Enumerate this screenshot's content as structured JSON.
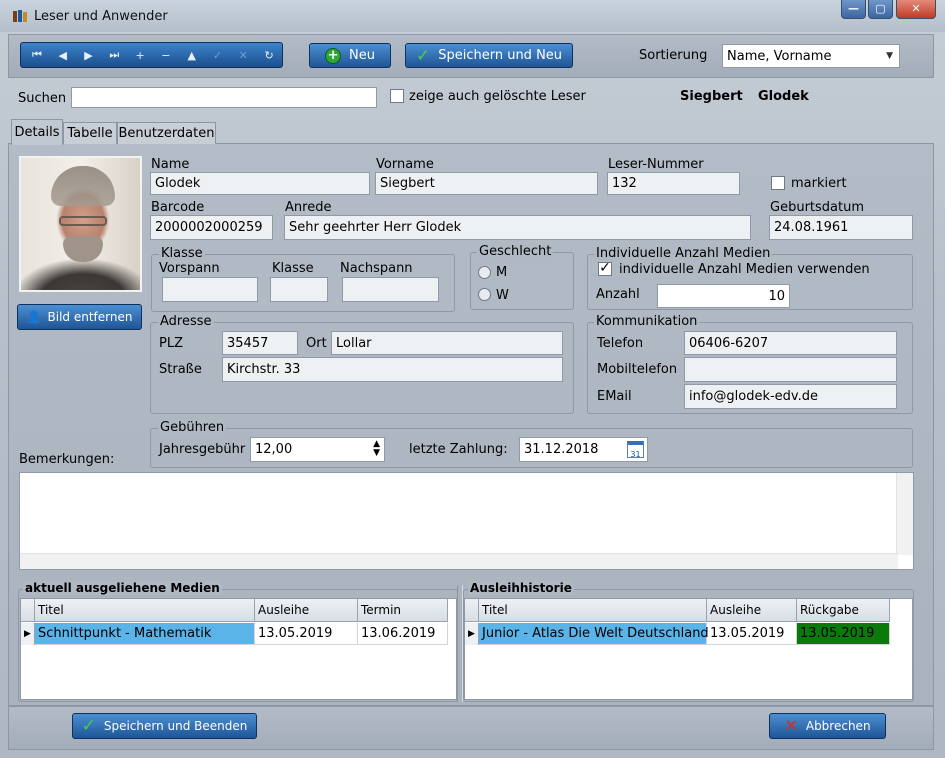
{
  "window": {
    "title": "Leser und Anwender",
    "min_glyph": "—",
    "max_glyph": "▢",
    "close_glyph": "✕"
  },
  "toolbar": {
    "nav_buttons": [
      {
        "glyph": "⏮"
      },
      {
        "glyph": "◀"
      },
      {
        "glyph": "▶"
      },
      {
        "glyph": "⏭"
      },
      {
        "glyph": "+"
      },
      {
        "glyph": "−"
      },
      {
        "glyph": "▲"
      },
      {
        "glyph": "✓"
      },
      {
        "glyph": "✕"
      },
      {
        "glyph": "↻"
      }
    ],
    "new_label": "Neu",
    "save_new_label": "Speichern und Neu",
    "sort_label": "Sortierung",
    "sort_value": "Name, Vorname",
    "sort_arrow": "▼"
  },
  "search": {
    "label": "Suchen",
    "value": "",
    "show_deleted_label": "zeige auch gelöschte Leser",
    "current_firstname": "Siegbert",
    "current_lastname": "Glodek"
  },
  "tabs": [
    {
      "label": "Details"
    },
    {
      "label": "Tabelle"
    },
    {
      "label": "Benutzerdaten"
    }
  ],
  "photo": {
    "remove_label": "Bild entfernen"
  },
  "person": {
    "name_label": "Name",
    "name": "Glodek",
    "vorname_label": "Vorname",
    "vorname": "Siegbert",
    "lesernr_label": "Leser-Nummer",
    "lesernr": "132",
    "markiert_label": "markiert",
    "barcode_label": "Barcode",
    "barcode": "2000002000259",
    "anrede_label": "Anrede",
    "anrede": "Sehr geehrter Herr Glodek",
    "geburt_label": "Geburtsdatum",
    "geburt": "24.08.1961"
  },
  "klasse": {
    "title": "Klasse",
    "vorspann_label": "Vorspann",
    "klasse_label": "Klasse",
    "nachspann_label": "Nachspann",
    "vorspann": "",
    "klasse": "",
    "nachspann": ""
  },
  "geschlecht": {
    "title": "Geschlecht",
    "m": "M",
    "w": "W"
  },
  "medien": {
    "title": "Individuelle Anzahl Medien",
    "use_label": "individuelle Anzahl Medien verwenden",
    "check_glyph": "✓",
    "anzahl_label": "Anzahl",
    "anzahl": "10"
  },
  "adresse": {
    "title": "Adresse",
    "plz_label": "PLZ",
    "plz": "35457",
    "ort_label": "Ort",
    "ort": "Lollar",
    "strasse_label": "Straße",
    "strasse": "Kirchstr. 33"
  },
  "kommunikation": {
    "title": "Kommunikation",
    "telefon_label": "Telefon",
    "telefon": "06406-6207",
    "mobil_label": "Mobiltelefon",
    "mobil": "",
    "email_label": "EMail",
    "email": "info@glodek-edv.de"
  },
  "gebuehren": {
    "title": "Gebühren",
    "jahres_label": "Jahresgebühr",
    "jahres": "12,00",
    "zahlung_label": "letzte Zahlung:",
    "zahlung": "31.12.2018",
    "cal_glyph": "31"
  },
  "bemerkungen": {
    "label": "Bemerkungen:",
    "value": ""
  },
  "ausgeliehen": {
    "title": "aktuell ausgeliehene Medien",
    "columns": [
      "Titel",
      "Ausleihe",
      "Termin"
    ],
    "rows": [
      [
        "Schnittpunkt - Mathematik",
        "13.05.2019",
        "13.06.2019"
      ]
    ]
  },
  "historie": {
    "title": "Ausleihhistorie",
    "columns": [
      "Titel",
      "Ausleihe",
      "Rückgabe"
    ],
    "rows": [
      [
        "Junior - Atlas Die Welt Deutschland",
        "13.05.2019",
        "13.05.2019"
      ]
    ]
  },
  "footer": {
    "save_close_label": "Speichern und Beenden",
    "cancel_label": "Abbrechen"
  },
  "colors": {
    "accent": "#2b6cb3",
    "selected_row": "#5ab4e8",
    "returned_green": "#0a7a0a"
  }
}
